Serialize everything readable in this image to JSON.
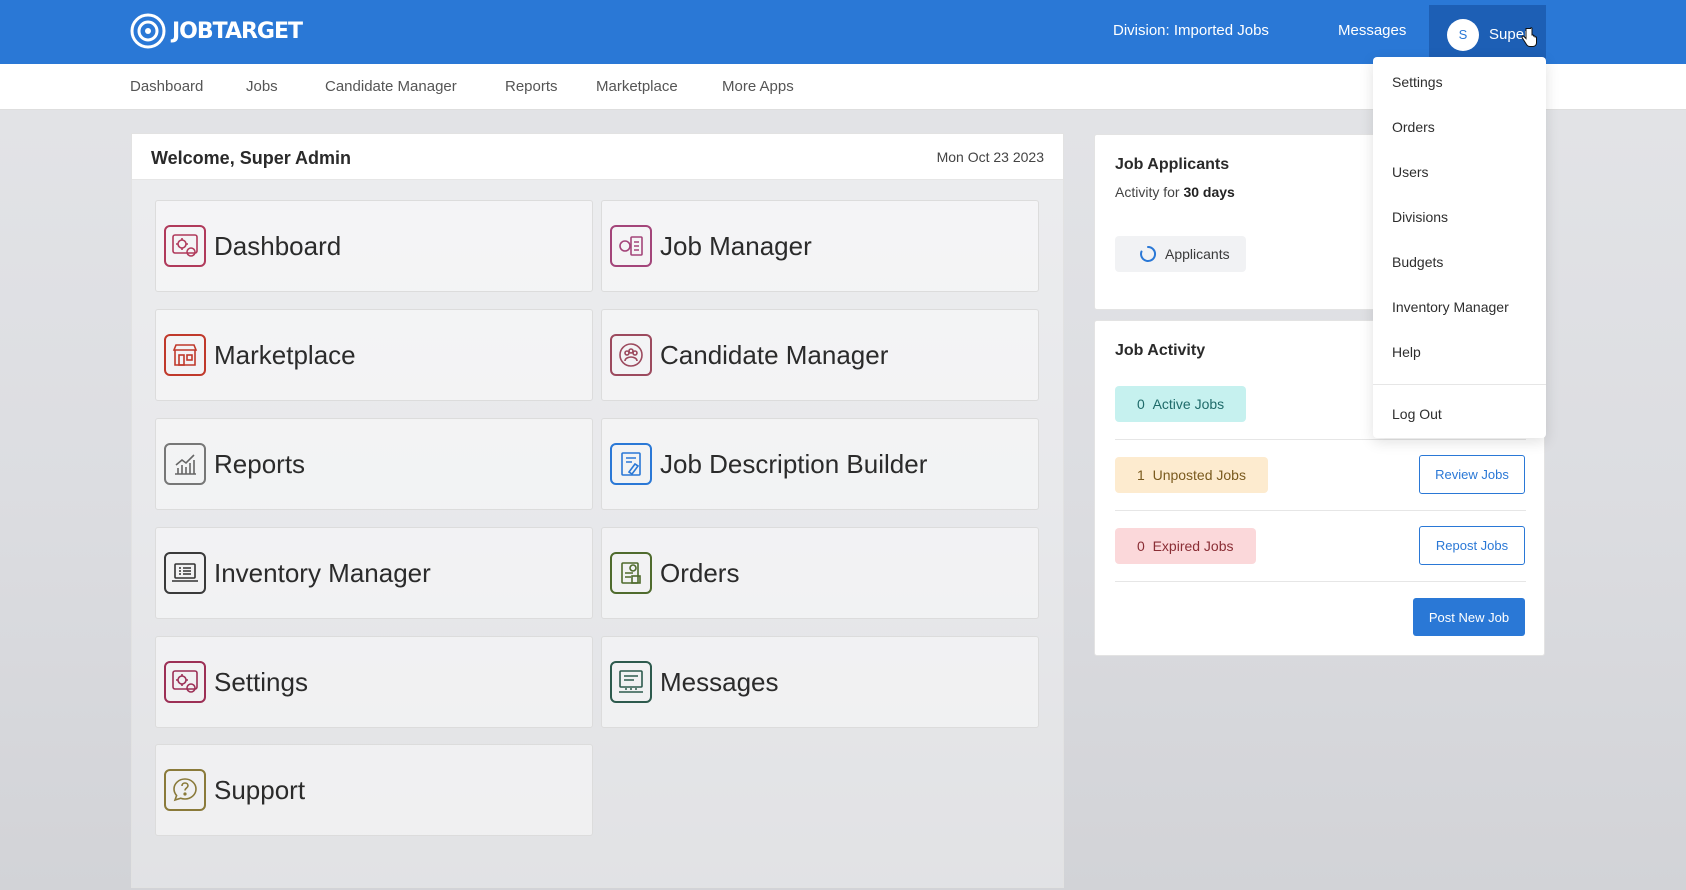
{
  "brand": {
    "name": "JOBTARGET"
  },
  "topbar": {
    "division_label": "Division:",
    "division_value": "Imported Jobs",
    "messages": "Messages",
    "user_initial": "S",
    "user_name": "Super"
  },
  "subnav": [
    "Dashboard",
    "Jobs",
    "Candidate Manager",
    "Reports",
    "Marketplace",
    "More Apps"
  ],
  "welcome": {
    "title": "Welcome, Super Admin",
    "date": "Mon Oct 23 2023",
    "tiles": [
      {
        "label": "Dashboard",
        "icon": "dashboard-gear-icon",
        "color": "#b03a5b"
      },
      {
        "label": "Job Manager",
        "icon": "job-manager-icon",
        "color": "#a3457a"
      },
      {
        "label": "Marketplace",
        "icon": "storefront-icon",
        "color": "#c0392b"
      },
      {
        "label": "Candidate Manager",
        "icon": "candidates-gear-icon",
        "color": "#9c4a5e"
      },
      {
        "label": "Reports",
        "icon": "bar-chart-icon",
        "color": "#777777"
      },
      {
        "label": "Job Description Builder",
        "icon": "document-builder-icon",
        "color": "#2a78d6"
      },
      {
        "label": "Inventory Manager",
        "icon": "laptop-list-icon",
        "color": "#3a3a3a"
      },
      {
        "label": "Orders",
        "icon": "orders-clipboard-icon",
        "color": "#4f6b2d"
      },
      {
        "label": "Settings",
        "icon": "settings-gear-icon",
        "color": "#9c2f55"
      },
      {
        "label": "Messages",
        "icon": "messages-screen-icon",
        "color": "#2d5a4d"
      },
      {
        "label": "Support",
        "icon": "help-bubble-icon",
        "color": "#8a7a3a"
      }
    ]
  },
  "job_applicants": {
    "title": "Job Applicants",
    "activity_prefix": "Activity for",
    "activity_period": "30 days",
    "applicants_label": "Applicants"
  },
  "job_activity": {
    "title": "Job Activity",
    "active": {
      "count": "0",
      "label": "Active Jobs"
    },
    "unposted": {
      "count": "1",
      "label": "Unposted Jobs",
      "action": "Review Jobs"
    },
    "expired": {
      "count": "0",
      "label": "Expired Jobs",
      "action": "Repost Jobs"
    },
    "post_new": "Post New Job"
  },
  "user_menu": [
    "Settings",
    "Orders",
    "Users",
    "Divisions",
    "Budgets",
    "Inventory Manager",
    "Help",
    "Log Out"
  ],
  "colors": {
    "primary": "#2a78d6",
    "active_pill": "#c6f1ef",
    "unposted_pill": "#fdebcf",
    "expired_pill": "#fbd8da"
  }
}
